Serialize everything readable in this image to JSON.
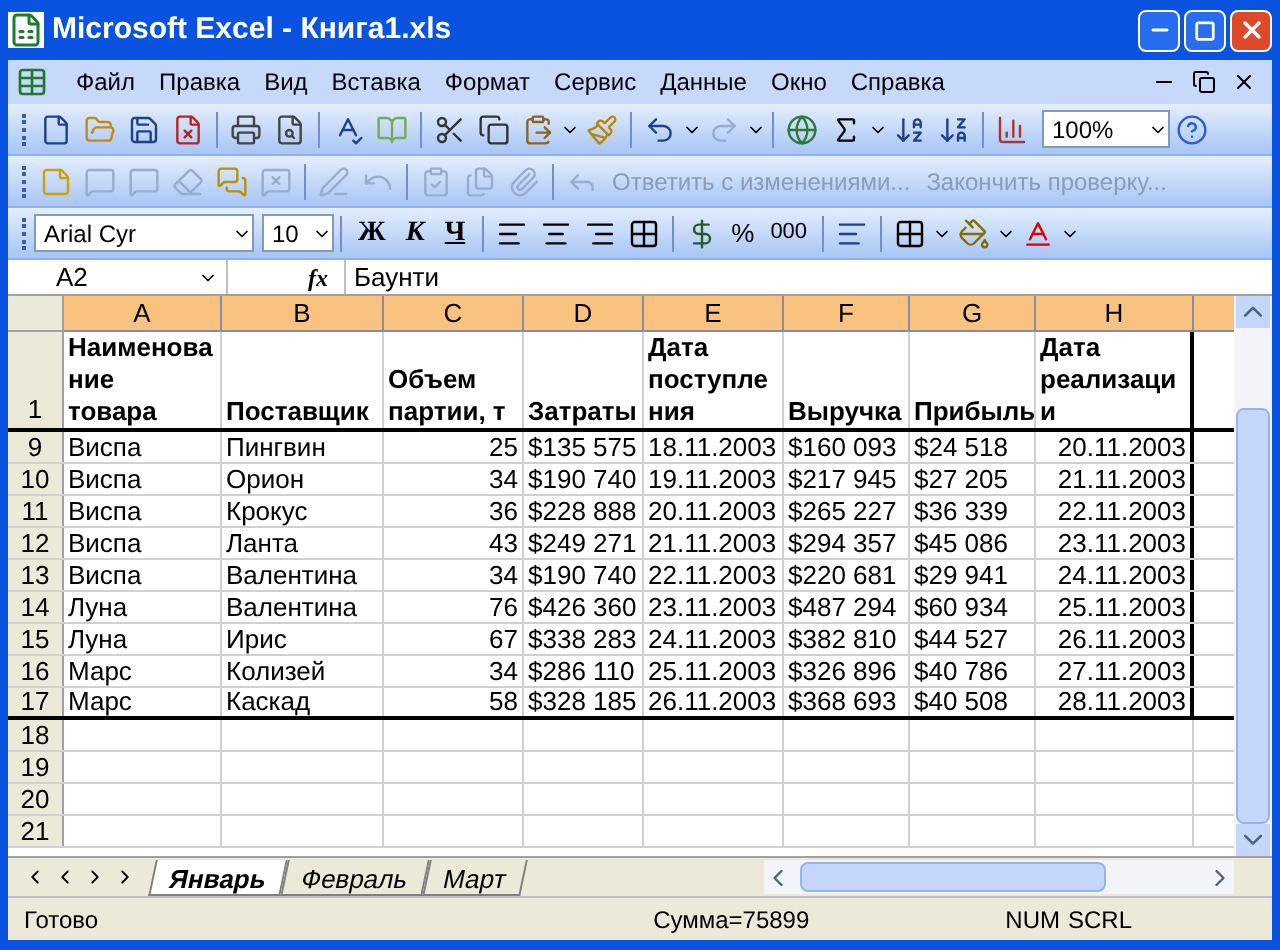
{
  "window": {
    "title": "Microsoft Excel - Книга1.xls"
  },
  "menu": [
    "Файл",
    "Правка",
    "Вид",
    "Вставка",
    "Формат",
    "Сервис",
    "Данные",
    "Окно",
    "Справка"
  ],
  "standard_toolbar": {
    "zoom": "100%"
  },
  "reviewing_toolbar": {
    "buttons": [
      {
        "label": "Ответить с изменениями...",
        "disabled": true
      },
      {
        "label": "Закончить проверку...",
        "disabled": true
      }
    ]
  },
  "formatting_toolbar": {
    "font": "Arial Cyr",
    "size": "10",
    "bold": "Ж",
    "italic": "К",
    "underline": "Ч",
    "percent": "%",
    "thousands": "000"
  },
  "formula_bar": {
    "name_box": "A2",
    "fx": "fx",
    "value": "Баунти"
  },
  "sheet": {
    "columns": [
      {
        "label": "A",
        "selected": true
      },
      {
        "label": "B",
        "selected": true
      },
      {
        "label": "C",
        "selected": true
      },
      {
        "label": "D",
        "selected": true
      },
      {
        "label": "E",
        "selected": true
      },
      {
        "label": "F",
        "selected": true
      },
      {
        "label": "G",
        "selected": true
      },
      {
        "label": "H",
        "selected": true
      }
    ],
    "header_row": {
      "number": "1",
      "cells": [
        [
          "Наименова",
          "ние",
          "товара"
        ],
        [
          "Поставщик"
        ],
        [
          "Объем",
          "партии, т"
        ],
        [
          "Затраты"
        ],
        [
          "Дата",
          "поступле",
          "ния"
        ],
        [
          "Выручка"
        ],
        [
          "Прибыль"
        ],
        [
          "Дата",
          "реализаци",
          "и"
        ]
      ]
    },
    "rows": [
      {
        "number": "9",
        "cells": [
          "Виспа",
          "Пингвин",
          "25",
          "$135 575",
          "18.11.2003",
          "$160 093",
          "$24 518",
          "20.11.2003"
        ]
      },
      {
        "number": "10",
        "cells": [
          "Виспа",
          "Орион",
          "34",
          "$190 740",
          "19.11.2003",
          "$217 945",
          "$27 205",
          "21.11.2003"
        ]
      },
      {
        "number": "11",
        "cells": [
          "Виспа",
          "Крокус",
          "36",
          "$228 888",
          "20.11.2003",
          "$265 227",
          "$36 339",
          "22.11.2003"
        ]
      },
      {
        "number": "12",
        "cells": [
          "Виспа",
          "Ланта",
          "43",
          "$249 271",
          "21.11.2003",
          "$294 357",
          "$45 086",
          "23.11.2003"
        ]
      },
      {
        "number": "13",
        "cells": [
          "Виспа",
          "Валентина",
          "34",
          "$190 740",
          "22.11.2003",
          "$220 681",
          "$29 941",
          "24.11.2003"
        ]
      },
      {
        "number": "14",
        "cells": [
          "Луна",
          "Валентина",
          "76",
          "$426 360",
          "23.11.2003",
          "$487 294",
          "$60 934",
          "25.11.2003"
        ]
      },
      {
        "number": "15",
        "cells": [
          "Луна",
          "Ирис",
          "67",
          "$338 283",
          "24.11.2003",
          "$382 810",
          "$44 527",
          "26.11.2003"
        ]
      },
      {
        "number": "16",
        "cells": [
          "Марс",
          "Колизей",
          "34",
          "$286 110",
          "25.11.2003",
          "$326 896",
          "$40 786",
          "27.11.2003"
        ]
      },
      {
        "number": "17",
        "cells": [
          "Марс",
          "Каскад",
          "58",
          "$328 185",
          "26.11.2003",
          "$368 693",
          "$40 508",
          "28.11.2003"
        ]
      }
    ],
    "empty_rows": [
      "18",
      "19",
      "20",
      "21"
    ]
  },
  "sheet_tabs": [
    {
      "label": "Январь",
      "selected": true
    },
    {
      "label": "Февраль",
      "selected": false
    },
    {
      "label": "Март",
      "selected": false
    }
  ],
  "status_bar": {
    "text": "Готово",
    "sum": "Сумма=75899",
    "indicators": [
      "NUM",
      "SCRL"
    ]
  }
}
